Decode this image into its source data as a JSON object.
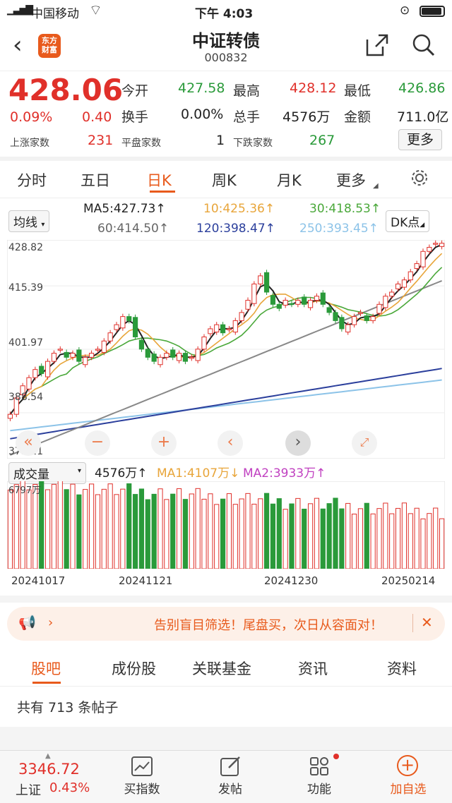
{
  "status_bar": {
    "carrier": "中国移动",
    "time": "下午 4:03"
  },
  "header": {
    "logo_text_1": "东方",
    "logo_text_2": "财富",
    "title": "中证转债",
    "code": "000832"
  },
  "quote": {
    "price": "428.06",
    "change_pct": "0.09%",
    "change": "0.40",
    "open_label": "今开",
    "open": "427.58",
    "high_label": "最高",
    "high": "428.12",
    "low_label": "最低",
    "low": "426.86",
    "turnover_label": "换手",
    "turnover": "0.00%",
    "volume_label": "总手",
    "volume": "4576万",
    "amount_label": "金额",
    "amount": "711.0亿",
    "up_label": "上涨家数",
    "up": "231",
    "flat_label": "平盘家数",
    "flat": "1",
    "down_label": "下跌家数",
    "down": "267",
    "more": "更多"
  },
  "chart_tabs": [
    "分时",
    "五日",
    "日K",
    "周K",
    "月K",
    "更多"
  ],
  "ma_panel": {
    "select": "均线",
    "dk": "DK点",
    "ma5": "MA5:427.73↑",
    "ma10": "10:425.36↑",
    "ma30": "30:418.53↑",
    "ma60": "60:414.50↑",
    "ma120": "120:398.47↑",
    "ma250": "250:393.45↑"
  },
  "price_axis": [
    "428.82",
    "415.39",
    "401.97",
    "388.54",
    "375.11"
  ],
  "volume_panel": {
    "select": "成交量",
    "vol": "4576万↑",
    "ma1": "MA1:4107万↓",
    "ma2": "MA2:3933万↑",
    "axis_top": "6797万"
  },
  "date_axis": [
    "20241017",
    "20241121",
    "20241230",
    "20250214"
  ],
  "colors": {
    "up": "#e0302a",
    "down": "#2a9a3a",
    "ma5": "#222222",
    "ma10": "#e8a53a",
    "ma30": "#4aa83a",
    "ma60": "#888888",
    "ma120": "#2b3f9c",
    "ma250": "#8cc3e8",
    "accent": "#e85a1c"
  },
  "banner": {
    "text": "告别盲目筛选！尾盘买，次日从容面对！"
  },
  "bottom_tabs": [
    "股吧",
    "成份股",
    "关联基金",
    "资讯",
    "资料"
  ],
  "posts": "共有 713 条帖子",
  "bottom_nav": {
    "index_value": "3346.72",
    "index_name": "上证",
    "index_pct": "0.43%",
    "items": [
      "买指数",
      "发帖",
      "功能",
      "加自选"
    ]
  },
  "chart_data": {
    "type": "candlestick",
    "ylim": [
      375.11,
      428.82
    ],
    "candles_close": [
      386,
      390,
      393,
      395,
      397,
      396,
      399,
      401,
      402,
      400,
      401,
      399,
      400,
      401,
      402,
      404,
      406,
      408,
      410,
      409,
      405,
      402,
      400,
      399,
      400,
      401,
      400,
      401,
      399,
      400,
      402,
      405,
      407,
      408,
      406,
      407,
      409,
      411,
      414,
      418,
      420,
      416,
      413,
      412,
      414,
      413,
      414,
      413,
      414,
      415,
      413,
      411,
      409,
      407,
      408,
      410,
      411,
      409,
      410,
      413,
      415,
      416,
      418,
      419,
      421,
      423,
      426,
      427,
      428,
      428
    ]
  }
}
